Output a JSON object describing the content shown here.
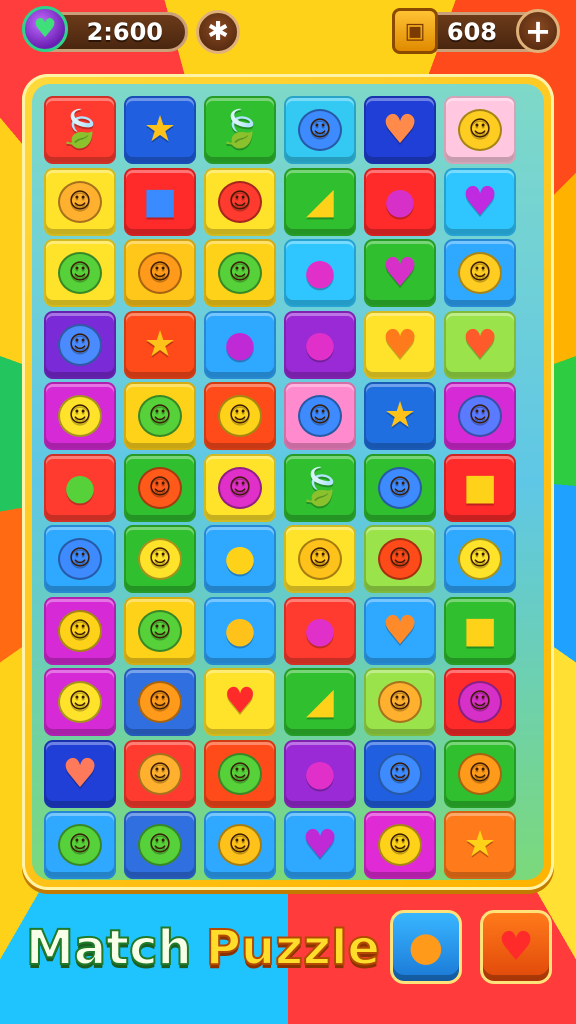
{
  "hud": {
    "score_value": "2:600",
    "score_icon": "heart-gem-icon",
    "settings_icon": "star-icon",
    "coins_value": "608",
    "coins_icon": "treasure-chest-icon",
    "add_label": "+"
  },
  "board": {
    "columns": 6,
    "rows": 11,
    "tiles": [
      [
        {
          "bg": "#ff3b2f",
          "icon": "leaf",
          "glyph": "🍃",
          "fg": "#7ed957"
        },
        {
          "bg": "#1f5fe0",
          "icon": "star-creature",
          "glyph": "★",
          "fg": "#ffc21a"
        },
        {
          "bg": "#2fbf2f",
          "icon": "leaf",
          "glyph": "🍃",
          "fg": "#9be34a"
        },
        {
          "bg": "#33c9f2",
          "icon": "blue-ghost",
          "glyph": "☺",
          "fg": "#3d8bff"
        },
        {
          "bg": "#1f3fd6",
          "icon": "heart",
          "glyph": "♥",
          "fg": "#ff8a4a"
        },
        {
          "bg": "#ffc8e0",
          "icon": "smiley",
          "glyph": "☺",
          "fg": "#ffcc22"
        }
      ],
      [
        {
          "bg": "#ffe22a",
          "icon": "sun-face",
          "glyph": "☼",
          "fg": "#ffb02e"
        },
        {
          "bg": "#ff2a2a",
          "icon": "gift-box",
          "glyph": "■",
          "fg": "#3a8bff"
        },
        {
          "bg": "#ffe22a",
          "icon": "red-face",
          "glyph": "☺",
          "fg": "#ff3b2f"
        },
        {
          "bg": "#2fbf2f",
          "icon": "cheese",
          "glyph": "◢",
          "fg": "#ffd21a"
        },
        {
          "bg": "#ff2a2a",
          "icon": "plum",
          "glyph": "●",
          "fg": "#d630c9"
        },
        {
          "bg": "#2fc6ff",
          "icon": "heart",
          "glyph": "♥",
          "fg": "#c02ae0"
        }
      ],
      [
        {
          "bg": "#ffe22a",
          "icon": "green-face",
          "glyph": "☺",
          "fg": "#57d13a"
        },
        {
          "bg": "#ffc71a",
          "icon": "orange-face",
          "glyph": "☺",
          "fg": "#ff9a1a"
        },
        {
          "bg": "#ffd21a",
          "icon": "green-face",
          "glyph": "☺",
          "fg": "#57d13a"
        },
        {
          "bg": "#2fc6ff",
          "icon": "plum",
          "glyph": "●",
          "fg": "#e030c9"
        },
        {
          "bg": "#2fbf2f",
          "icon": "heart",
          "glyph": "♥",
          "fg": "#d630c9"
        },
        {
          "bg": "#2fa8ff",
          "icon": "smiley",
          "glyph": "☺",
          "fg": "#ffcc22"
        }
      ],
      [
        {
          "bg": "#7a2ad6",
          "icon": "blue-monster",
          "glyph": "☺",
          "fg": "#4a8bff"
        },
        {
          "bg": "#ff4a1a",
          "icon": "star-creature",
          "glyph": "★",
          "fg": "#ffc21a"
        },
        {
          "bg": "#2fa8ff",
          "icon": "eggplant",
          "glyph": "●",
          "fg": "#c02ad6"
        },
        {
          "bg": "#9a2ad6",
          "icon": "radish",
          "glyph": "●",
          "fg": "#e030c9"
        },
        {
          "bg": "#ffe22a",
          "icon": "heart",
          "glyph": "♥",
          "fg": "#ff7a1a"
        },
        {
          "bg": "#9be34a",
          "icon": "heart",
          "glyph": "♥",
          "fg": "#ff5a2a"
        }
      ],
      [
        {
          "bg": "#d62ad6",
          "icon": "smiley",
          "glyph": "☺",
          "fg": "#ffe22a"
        },
        {
          "bg": "#ffd21a",
          "icon": "green-face",
          "glyph": "☺",
          "fg": "#57d13a"
        },
        {
          "bg": "#ff4a1a",
          "icon": "sun-face",
          "glyph": "☼",
          "fg": "#ffd21a"
        },
        {
          "bg": "#ff8acd",
          "icon": "blue-ghost",
          "glyph": "☺",
          "fg": "#3d8bff"
        },
        {
          "bg": "#1f6fe0",
          "icon": "star-creature",
          "glyph": "★",
          "fg": "#ffc21a"
        },
        {
          "bg": "#d62ad6",
          "icon": "blue-bird",
          "glyph": "☺",
          "fg": "#5a7aff"
        }
      ],
      [
        {
          "bg": "#ff3b2f",
          "icon": "green-ball",
          "glyph": "●",
          "fg": "#57d13a"
        },
        {
          "bg": "#2fbf2f",
          "icon": "orange-face",
          "glyph": "☺",
          "fg": "#ff5a1a"
        },
        {
          "bg": "#ffe22a",
          "icon": "pink-face",
          "glyph": "☺",
          "fg": "#e030c9"
        },
        {
          "bg": "#2fbf2f",
          "icon": "leaf",
          "glyph": "🍃",
          "fg": "#7ed957"
        },
        {
          "bg": "#2fbf2f",
          "icon": "blue-bird",
          "glyph": "☺",
          "fg": "#3d8bff"
        },
        {
          "bg": "#ff2a2a",
          "icon": "cheese",
          "glyph": "■",
          "fg": "#ffd21a"
        }
      ],
      [
        {
          "bg": "#2fa8ff",
          "icon": "blue-ghost",
          "glyph": "☺",
          "fg": "#3d8bff"
        },
        {
          "bg": "#2fbf2f",
          "icon": "smiley",
          "glyph": "☺",
          "fg": "#ffe22a"
        },
        {
          "bg": "#2fa8ff",
          "icon": "lemon",
          "glyph": "●",
          "fg": "#ffd21a"
        },
        {
          "bg": "#ffe22a",
          "icon": "octopus",
          "glyph": "☺",
          "fg": "#ffc21a"
        },
        {
          "bg": "#9be34a",
          "icon": "red-face",
          "glyph": "☺",
          "fg": "#ff4a1a"
        },
        {
          "bg": "#2fa8ff",
          "icon": "smiley",
          "glyph": "☺",
          "fg": "#ffe22a"
        }
      ],
      [
        {
          "bg": "#d62ad6",
          "icon": "sun-face",
          "glyph": "☼",
          "fg": "#ffd21a"
        },
        {
          "bg": "#ffd21a",
          "icon": "green-face",
          "glyph": "☺",
          "fg": "#57d13a"
        },
        {
          "bg": "#2fa8ff",
          "icon": "lemon",
          "glyph": "●",
          "fg": "#ffc21a"
        },
        {
          "bg": "#ff3b2f",
          "icon": "plum",
          "glyph": "●",
          "fg": "#e030c9"
        },
        {
          "bg": "#2fa8ff",
          "icon": "heart",
          "glyph": "♥",
          "fg": "#ff8a2a"
        },
        {
          "bg": "#2fbf2f",
          "icon": "cheese",
          "glyph": "■",
          "fg": "#ffd21a"
        }
      ],
      [
        {
          "bg": "#d62ad6",
          "icon": "smiley",
          "glyph": "☺",
          "fg": "#ffe22a"
        },
        {
          "bg": "#2f6fe0",
          "icon": "octopus",
          "glyph": "★",
          "fg": "#ff9a1a"
        },
        {
          "bg": "#ffe22a",
          "icon": "apple",
          "glyph": "♥",
          "fg": "#ff2a2a"
        },
        {
          "bg": "#2fbf2f",
          "icon": "cheese",
          "glyph": "◢",
          "fg": "#ffd21a"
        },
        {
          "bg": "#9be34a",
          "icon": "sun-face",
          "glyph": "☼",
          "fg": "#ffb02e"
        },
        {
          "bg": "#ff2a2a",
          "icon": "pink-face",
          "glyph": "☺",
          "fg": "#d630c9"
        }
      ],
      [
        {
          "bg": "#1f3fd6",
          "icon": "heart",
          "glyph": "♥",
          "fg": "#ff7a5a"
        },
        {
          "bg": "#ff3b2f",
          "icon": "smiley",
          "glyph": "☺",
          "fg": "#ffb02e"
        },
        {
          "bg": "#ff4a1a",
          "icon": "green-face",
          "glyph": "☺",
          "fg": "#57d13a"
        },
        {
          "bg": "#9a2ad6",
          "icon": "plum",
          "glyph": "●",
          "fg": "#e030c9"
        },
        {
          "bg": "#1f5fe0",
          "icon": "blue-bird",
          "glyph": "☺",
          "fg": "#3d8bff"
        },
        {
          "bg": "#2fbf2f",
          "icon": "orange-face",
          "glyph": "☺",
          "fg": "#ff9a1a"
        }
      ],
      [
        {
          "bg": "#2fa8ff",
          "icon": "green-face",
          "glyph": "☺",
          "fg": "#57d13a"
        },
        {
          "bg": "#2f6fe0",
          "icon": "green-face",
          "glyph": "☺",
          "fg": "#57d13a"
        },
        {
          "bg": "#2fa8ff",
          "icon": "orange-face",
          "glyph": "☺",
          "fg": "#ffc21a"
        },
        {
          "bg": "#2fa8ff",
          "icon": "heart",
          "glyph": "♥",
          "fg": "#c02ad6"
        },
        {
          "bg": "#e02ad6",
          "icon": "sun-face",
          "glyph": "☼",
          "fg": "#ffd21a"
        },
        {
          "bg": "#ff7a1a",
          "icon": "star-creature",
          "glyph": "★",
          "fg": "#ffd21a"
        }
      ]
    ]
  },
  "footer": {
    "title_word1": "Match",
    "title_word2": "Puzzle",
    "powerup1_icon": "orange-fruit-icon",
    "powerup1_glyph": "●",
    "powerup1_color": "#ff9a1a",
    "powerup2_icon": "strawberry-icon",
    "powerup2_glyph": "♥",
    "powerup2_color": "#ff2a2a"
  }
}
